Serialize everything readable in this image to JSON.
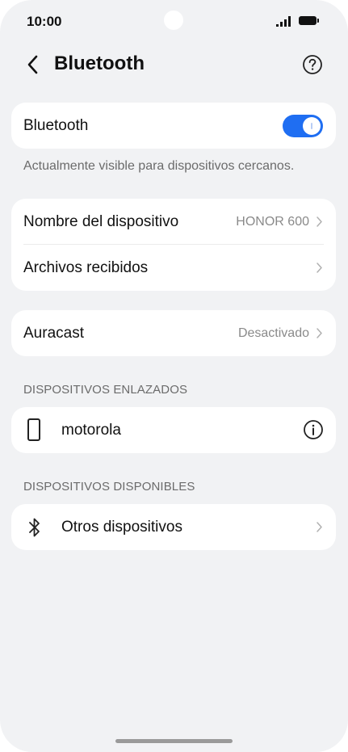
{
  "status_bar": {
    "time": "10:00"
  },
  "header": {
    "title": "Bluetooth"
  },
  "bluetooth_toggle": {
    "label": "Bluetooth",
    "enabled": true,
    "accent": "#1f6ef2"
  },
  "visibility_caption": "Actualmente visible para dispositivos cercanos.",
  "device_settings": {
    "name_label": "Nombre del dispositivo",
    "name_value": "HONOR 600",
    "received_label": "Archivos recibidos"
  },
  "auracast": {
    "label": "Auracast",
    "value": "Desactivado"
  },
  "paired_section": {
    "title": "DISPOSITIVOS ENLAZADOS",
    "devices": [
      {
        "name": "motorola",
        "icon": "phone-icon"
      }
    ]
  },
  "available_section": {
    "title": "DISPOSITIVOS DISPONIBLES",
    "other_label": "Otros dispositivos"
  }
}
